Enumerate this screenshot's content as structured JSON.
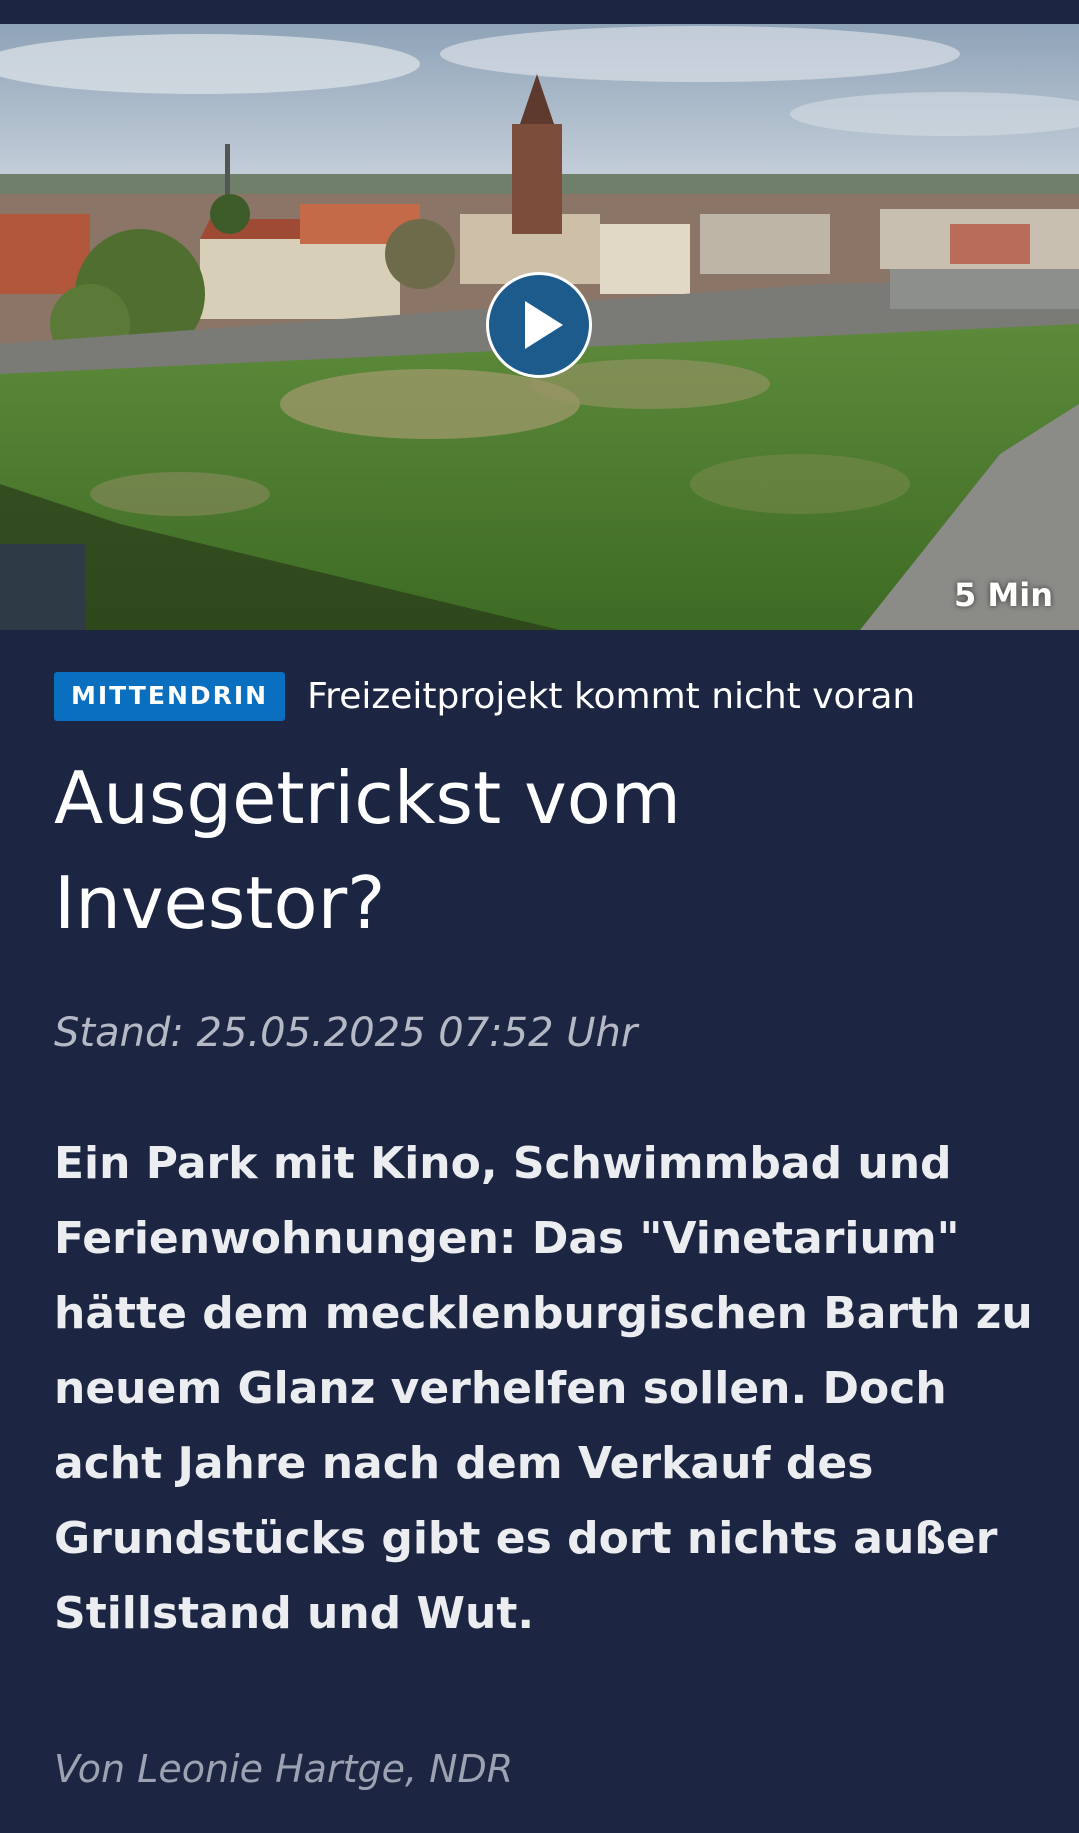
{
  "video": {
    "duration": "5 Min",
    "play_label": "play"
  },
  "article": {
    "badge": "MITTENDRIN",
    "kicker": "Freizeitprojekt kommt nicht voran",
    "headline": "Ausgetrickst vom Investor?",
    "dateline": "Stand: 25.05.2025 07:52 Uhr",
    "teaser": "Ein Park mit Kino, Schwimmbad und Ferienwohnungen: Das \"Vinetarium\" hätte dem mecklenburgischen Barth zu neuem Glanz verhelfen sollen. Doch acht Jahre nach dem Verkauf des Grundstücks gibt es dort nichts außer Stillstand und Wut.",
    "author": "Von Leonie Hartge, NDR"
  },
  "colors": {
    "background": "#1c2541",
    "badge": "#0b6fc0",
    "play_button": "#1d5b8c",
    "dateline": "#b5b9c6",
    "author": "#9da2b2"
  },
  "icons": {
    "play": "play-icon"
  }
}
